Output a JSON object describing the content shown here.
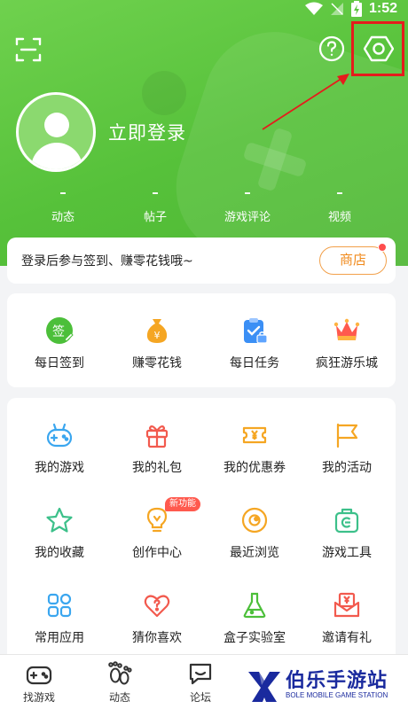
{
  "status_bar": {
    "time": "1:52"
  },
  "profile": {
    "login_label": "立即登录"
  },
  "stats": [
    {
      "value": "–",
      "label": "动态"
    },
    {
      "value": "–",
      "label": "帖子"
    },
    {
      "value": "–",
      "label": "游戏评论"
    },
    {
      "value": "–",
      "label": "视频"
    }
  ],
  "notice": {
    "text": "登录后参与签到、赚零花钱哦~",
    "shop_label": "商店"
  },
  "quick_actions": [
    {
      "label": "每日签到",
      "icon": "sign-in-icon",
      "icon_text": "签",
      "color": "#4cbf3a"
    },
    {
      "label": "赚零花钱",
      "icon": "money-bag-icon",
      "icon_text": "¥",
      "color": "#f5a623"
    },
    {
      "label": "每日任务",
      "icon": "task-clipboard-icon",
      "color": "#3b8ff5"
    },
    {
      "label": "疯狂游乐城",
      "icon": "crown-icon",
      "color": "#ff5a4e"
    }
  ],
  "menu": [
    {
      "label": "我的游戏",
      "icon": "gamepad-icon",
      "color": "#3aa6ef"
    },
    {
      "label": "我的礼包",
      "icon": "gift-icon",
      "color": "#f25a4e"
    },
    {
      "label": "我的优惠券",
      "icon": "coupon-icon",
      "color": "#f5a623"
    },
    {
      "label": "我的活动",
      "icon": "flag-icon",
      "color": "#f5a623"
    },
    {
      "label": "我的收藏",
      "icon": "star-icon",
      "color": "#3cc08a"
    },
    {
      "label": "创作中心",
      "icon": "lightbulb-icon",
      "color": "#f5a623",
      "badge": "新功能"
    },
    {
      "label": "最近浏览",
      "icon": "eye-icon",
      "color": "#f5a623"
    },
    {
      "label": "游戏工具",
      "icon": "toolbox-icon",
      "color": "#3cc08a"
    },
    {
      "label": "常用应用",
      "icon": "apps-grid-icon",
      "color": "#3aa6ef"
    },
    {
      "label": "猜你喜欢",
      "icon": "heart-question-icon",
      "color": "#f25a4e"
    },
    {
      "label": "盒子实验室",
      "icon": "flask-icon",
      "color": "#4cbf3a"
    },
    {
      "label": "邀请有礼",
      "icon": "invite-envelope-icon",
      "color": "#f25a4e"
    }
  ],
  "bottom_nav": [
    {
      "label": "找游戏",
      "icon": "gamepad-nav-icon"
    },
    {
      "label": "动态",
      "icon": "footprint-icon"
    },
    {
      "label": "论坛",
      "icon": "chat-bubble-icon"
    }
  ],
  "watermark": {
    "title": "伯乐手游站",
    "subtitle": "BOLE MOBILE GAME STATION"
  },
  "colors": {
    "primary": "#5cc440",
    "highlight": "#e51c1c",
    "accent": "#f08a1c"
  }
}
